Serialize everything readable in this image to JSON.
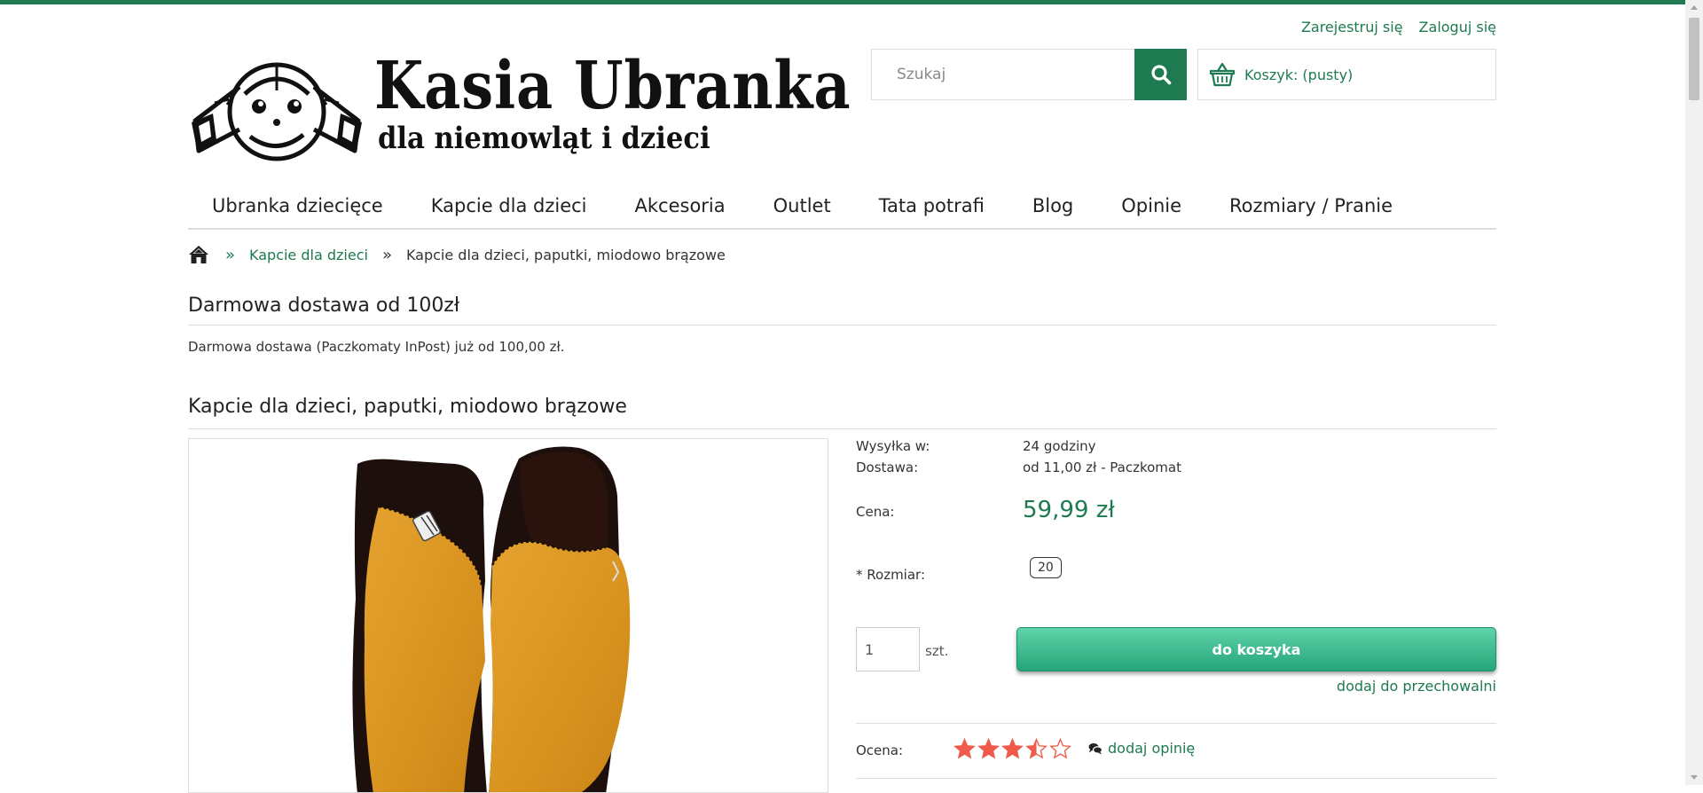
{
  "header": {
    "register_label": "Zarejestruj się",
    "login_label": "Zaloguj się",
    "logo": {
      "title": "Kasia Ubranka",
      "subtitle": "dla niemowląt i dzieci"
    },
    "search": {
      "placeholder": "Szukaj",
      "value": ""
    },
    "cart": {
      "label": "Koszyk: (pusty)"
    }
  },
  "nav": {
    "items": [
      {
        "label": "Ubranka dziecięce"
      },
      {
        "label": "Kapcie dla dzieci"
      },
      {
        "label": "Akcesoria"
      },
      {
        "label": "Outlet"
      },
      {
        "label": "Tata potrafi"
      },
      {
        "label": "Blog"
      },
      {
        "label": "Opinie"
      },
      {
        "label": "Rozmiary / Pranie"
      }
    ]
  },
  "breadcrumb": {
    "separator": "»",
    "category": "Kapcie dla dzieci",
    "current": "Kapcie dla dzieci, paputki, miodowo brązowe"
  },
  "free_shipping": {
    "title": "Darmowa dostawa od 100zł",
    "text": "Darmowa dostawa (Paczkomaty InPost) już od 100,00 zł."
  },
  "product": {
    "title": "Kapcie dla dzieci, paputki, miodowo brązowe",
    "shipping_label": "Wysyłka w:",
    "shipping_value": "24 godziny",
    "delivery_label": "Dostawa:",
    "delivery_value": "od 11,00 zł - Paczkomat",
    "price_label": "Cena:",
    "price_value": "59,99 zł",
    "size_label": "* Rozmiar:",
    "size_value": "20",
    "quantity": "1",
    "quantity_unit": "szt.",
    "add_to_cart": "do koszyka",
    "add_to_storage": "dodaj do przechowalni",
    "rating_label": "Ocena:",
    "rating_value": 3.5,
    "rating_max": 5,
    "add_review": "dodaj opinię"
  },
  "colors": {
    "brand_green": "#1e7a50",
    "button_gradient_top": "#5fd3aa",
    "button_gradient_bottom": "#26a57a",
    "star_color": "#f05a4a"
  },
  "icons": [
    "home-icon",
    "search-icon",
    "basket-icon",
    "comments-icon",
    "star-icon"
  ]
}
